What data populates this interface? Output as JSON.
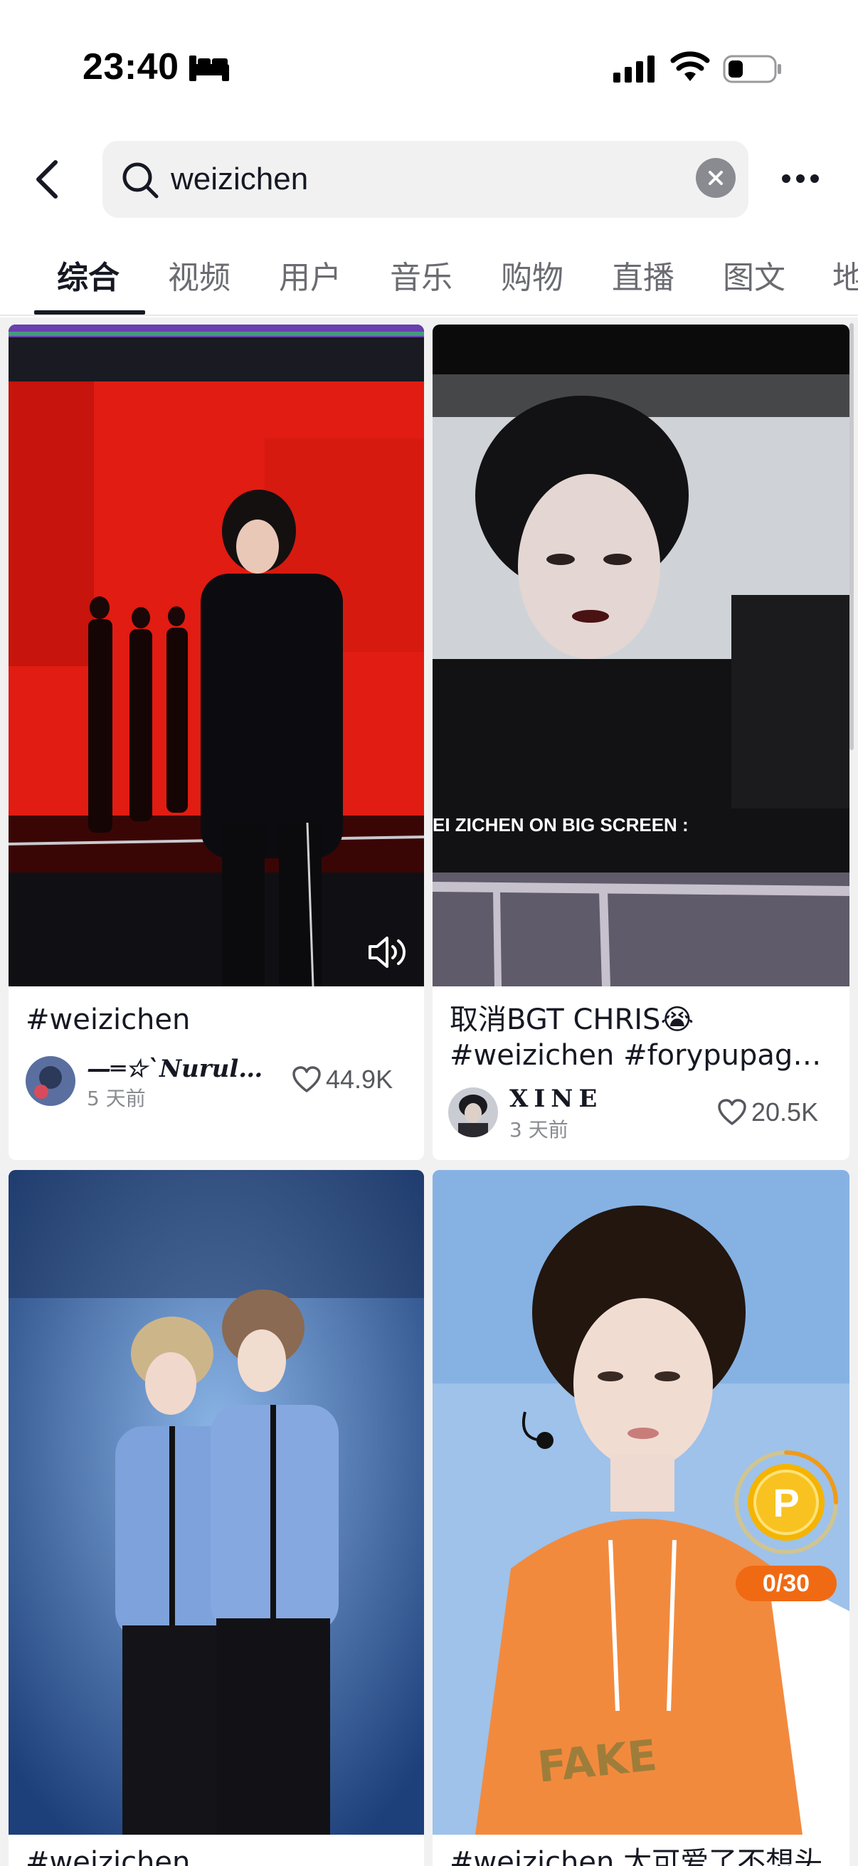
{
  "status_bar": {
    "time": "23:40",
    "icons": [
      "bed-icon",
      "signal-icon",
      "wifi-icon",
      "battery-icon"
    ]
  },
  "search": {
    "value": "weizichen",
    "icons": [
      "back-icon",
      "search-icon",
      "clear-icon",
      "more-icon"
    ]
  },
  "tabs": [
    "综合",
    "视频",
    "用户",
    "音乐",
    "购物",
    "直播",
    "图文",
    "地"
  ],
  "active_tab": "综合",
  "cards": [
    {
      "title": "#weizichen",
      "author": "—═☆`𝑵𝒖𝒓𝒖𝒍_...",
      "time": "5 天前",
      "likes": "44.9K",
      "icons": [
        "volume-icon",
        "heart-icon"
      ]
    },
    {
      "title_line1": "取消BGT CHRIS😭",
      "title_line2": "#weizichen #forypupage...",
      "overlay_text": "EI ZICHEN ON BIG SCREEN :",
      "author": "XINE",
      "time": "3 天前",
      "likes": "20.5K",
      "icons": [
        "heart-icon"
      ]
    },
    {
      "title": "#weizichen"
    },
    {
      "title": "#weizichen 太可爱了不想头"
    }
  ],
  "coin_widget": {
    "label": "P",
    "counter": "0/30",
    "progress": 0
  },
  "colors": {
    "accent": "#161823",
    "coin_orange": "#f06a13",
    "coin_gold": "#f5b400"
  }
}
